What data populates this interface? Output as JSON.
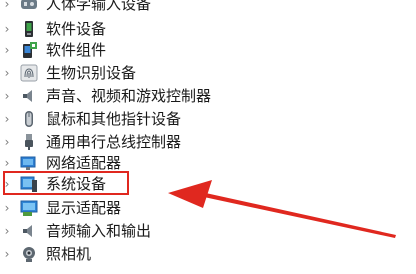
{
  "device_manager": {
    "items": [
      {
        "label": "人体学输入设备",
        "icon": "human-interface-icon"
      },
      {
        "label": "软件设备",
        "icon": "software-device-icon"
      },
      {
        "label": "软件组件",
        "icon": "software-component-icon"
      },
      {
        "label": "生物识别设备",
        "icon": "fingerprint-icon"
      },
      {
        "label": "声音、视频和游戏控制器",
        "icon": "speaker-icon"
      },
      {
        "label": "鼠标和其他指针设备",
        "icon": "mouse-icon"
      },
      {
        "label": "通用串行总线控制器",
        "icon": "usb-icon"
      },
      {
        "label": "网络适配器",
        "icon": "network-adapter-icon"
      },
      {
        "label": "系统设备",
        "icon": "system-device-icon"
      },
      {
        "label": "显示适配器",
        "icon": "display-adapter-icon"
      },
      {
        "label": "音频输入和输出",
        "icon": "audio-io-icon"
      },
      {
        "label": "照相机",
        "icon": "camera-icon"
      }
    ],
    "expand_glyph": "›"
  },
  "annotation": {
    "highlight_color": "#e0281f",
    "highlighted_item": "系统设备"
  }
}
